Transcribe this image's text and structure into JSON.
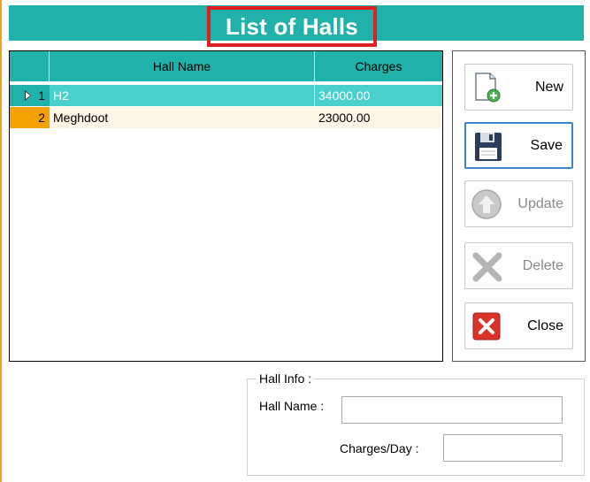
{
  "window": {
    "title": "List of Halls"
  },
  "grid": {
    "columns": [
      "Hall Name",
      "Charges"
    ],
    "rows": [
      {
        "num": "1",
        "hall_name": "H2",
        "charges": "34000.00",
        "selected": true
      },
      {
        "num": "2",
        "hall_name": "Meghdoot",
        "charges": "23000.00",
        "selected": false
      }
    ]
  },
  "buttons": {
    "new": "New",
    "save": "Save",
    "update": "Update",
    "delete": "Delete",
    "close": "Close"
  },
  "hall_info": {
    "title": "Hall Info :",
    "hall_name_label": "Hall Name :",
    "hall_name_value": "",
    "charges_label": "Charges/Day :",
    "charges_value": ""
  },
  "colors": {
    "accent_teal": "#20b2aa",
    "selected_row": "#48d1cc",
    "title_highlight": "#e02020",
    "row_marker": "#f5a100"
  },
  "icons": {
    "new": "new-document-icon",
    "save": "floppy-disk-icon",
    "update": "up-arrow-icon",
    "delete": "x-mark-icon",
    "close": "close-x-icon"
  }
}
